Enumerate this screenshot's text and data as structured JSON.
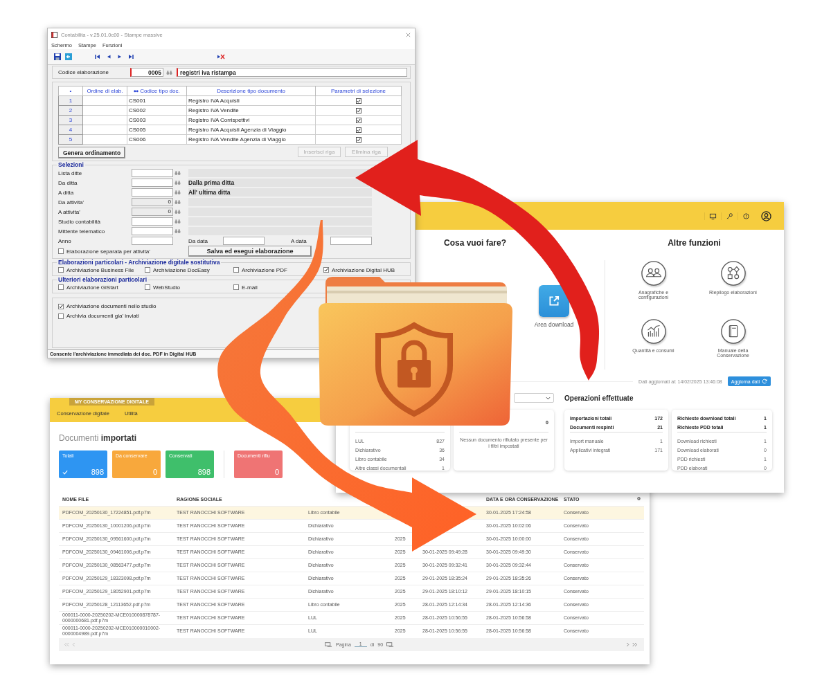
{
  "accounting_window": {
    "title": "Contabilita - v.25.01.0c00 - Stampe massive",
    "menu": [
      "Schermo",
      "Stampe",
      "Funzioni"
    ],
    "code_row": {
      "label": "Codice elaborazione",
      "code": "0005",
      "description": "registri iva ristampa"
    },
    "table": {
      "columns": [
        "•",
        "Ordine di elab.",
        "Codice tipo doc.",
        "Descrizione tipo documento",
        "Parametri di selezione"
      ],
      "rows": [
        {
          "index": "1",
          "code": "CS001",
          "description": "Registro IVA Acquisti",
          "checked": true
        },
        {
          "index": "2",
          "code": "CS002",
          "description": "Registro IVA Vendite",
          "checked": true
        },
        {
          "index": "3",
          "code": "CS003",
          "description": "Registro IVA Corrispettivi",
          "checked": true
        },
        {
          "index": "4",
          "code": "CS005",
          "description": "Registro IVA Acquisti Agenzia di Viaggio",
          "checked": true
        },
        {
          "index": "5",
          "code": "CS006",
          "description": "Registro IVA Vendite Agenzia di Viaggio",
          "checked": true
        }
      ]
    },
    "table_buttons": [
      {
        "label": "Genera ordinamento",
        "disabled": false
      },
      {
        "label": "Inserisci riga",
        "disabled": true
      },
      {
        "label": "Elimina riga",
        "disabled": true
      }
    ],
    "selezioni": {
      "title": "Selezioni",
      "fields": [
        {
          "label": "Lista ditte",
          "disabled": false
        },
        {
          "label": "Da ditta",
          "disabled": false,
          "info": "Dalla prima ditta"
        },
        {
          "label": "A ditta",
          "disabled": false,
          "info": "All' ultima ditta"
        },
        {
          "label": "Da attivita'",
          "disabled": true,
          "value": "0"
        },
        {
          "label": "A attivita'",
          "disabled": true,
          "value": "0"
        },
        {
          "label": "Studio contabilità",
          "disabled": false
        },
        {
          "label": "Mittente telematico",
          "disabled": false
        }
      ],
      "anno": {
        "label": "Anno",
        "from_label": "Da data",
        "to_label": "A data"
      },
      "separate": {
        "label": "Elaborazione separata per attivita'",
        "checked": false
      },
      "run_button": "Salva ed esegui elaborazione"
    },
    "elaborazioni": {
      "title": "Elaborazioni particolari - Archiviazione digitale sostitutiva",
      "options": [
        {
          "label": "Archiviazione Business File",
          "checked": false
        },
        {
          "label": "Archiviazione DocEasy",
          "checked": false
        },
        {
          "label": "Archiviazione PDF",
          "checked": false
        },
        {
          "label": "Archiviazione Digital HUB",
          "checked": true
        }
      ]
    },
    "ulteriori": {
      "title": "Ulteriori elaborazioni particolari",
      "options": [
        {
          "label": "Archiviazione GiStart",
          "checked": false
        },
        {
          "label": "WebStudio",
          "checked": false
        },
        {
          "label": "E-mail",
          "checked": false
        }
      ]
    },
    "archive_options": [
      {
        "label": "Archiviazione documenti nello studio",
        "checked": true
      },
      {
        "label": "Archivia documenti gia' inviati",
        "checked": false
      }
    ],
    "status_bar": "Consente l'archiviazione immediata dei doc. PDF in Digital HUB"
  },
  "dashboard_window": {
    "left_title": "Cosa vuoi fare?",
    "tile": "Area download",
    "right_title": "Altre funzioni",
    "functions": [
      {
        "label": "Anagrafiche e configurazioni",
        "kind": "people"
      },
      {
        "label": "Riepilogo elaborazioni",
        "kind": "shapes"
      },
      {
        "label": "Quantità e consumi",
        "kind": "chart"
      },
      {
        "label": "Manuale della Conservazione",
        "kind": "book"
      }
    ],
    "updated": "Dati aggiornati al: 14/02/2025 13:46:08",
    "refresh_button": "Aggiorna dati",
    "operations_title": "Operazioni effettuate",
    "cards": [
      {
        "rows": [
          {
            "label": "LUL",
            "value": "827"
          },
          {
            "label": "Dichiarativo",
            "value": "36"
          },
          {
            "label": "Libro contabile",
            "value": "34"
          },
          {
            "label": "Altre classi documentali",
            "value": "1"
          }
        ]
      },
      {
        "header": [
          {
            "value": "0"
          }
        ],
        "message": "Nessun documento rifiutato presente per i filtri impostati"
      },
      {
        "header": [
          {
            "label": "Importazioni totali",
            "value": "172"
          },
          {
            "label": "Documenti respinti",
            "value": "21"
          }
        ],
        "rows": [
          {
            "label": "Import manuale",
            "value": "1"
          },
          {
            "label": "Applicativi integrati",
            "value": "171"
          }
        ]
      },
      {
        "header": [
          {
            "label": "Richieste download totali",
            "value": "1"
          },
          {
            "label": "Richieste PDD totali",
            "value": "1"
          }
        ],
        "rows": [
          {
            "label": "Download richiesti",
            "value": "1"
          },
          {
            "label": "Download elaborati",
            "value": "0"
          },
          {
            "label": "PDD richiesti",
            "value": "1"
          },
          {
            "label": "PDD elaborati",
            "value": "0"
          }
        ]
      }
    ]
  },
  "archive_window": {
    "app_tab": "MY CONSERVAZIONE DIGITALE",
    "nav": [
      "Conservazione digitale",
      "Utilità"
    ],
    "page_title": "Documenti **importati**",
    "counters": [
      {
        "label": "Totali",
        "value": "898",
        "color": "#2e95f2",
        "selected": true
      },
      {
        "label": "Da conservare",
        "value": "0",
        "color": "#f8a83c",
        "selected": false
      },
      {
        "label": "Conservati",
        "value": "898",
        "color": "#3fbf6b",
        "selected": false
      }
    ],
    "rejected_counter": {
      "label": "Documenti rifiu",
      "value": "0",
      "color": "#ef7474"
    },
    "table": {
      "columns": [
        "NOME FILE",
        "RAGIONE SOCIALE",
        null,
        null,
        null,
        "DATA E ORA CONSERVAZIONE",
        "STATO"
      ],
      "rows": [
        {
          "selected": true,
          "cells": [
            "PDFCOM_20250130_17224851.pdf.p7m",
            "TEST RANOCCHI SOFTWARE",
            "Libro contabile",
            null,
            null,
            "30-01-2025 17:24:58",
            "Conservato"
          ]
        },
        {
          "selected": false,
          "cells": [
            "PDFCOM_20250130_10001206.pdf.p7m",
            "TEST RANOCCHI SOFTWARE",
            "Dichiarativo",
            null,
            null,
            "30-01-2025 10:02:06",
            "Conservato"
          ]
        },
        {
          "selected": false,
          "cells": [
            "PDFCOM_20250130_09561600.pdf.p7m",
            "TEST RANOCCHI SOFTWARE",
            "Dichiarativo",
            "2025",
            null,
            "30-01-2025 10:00:00",
            "Conservato"
          ]
        },
        {
          "selected": false,
          "cells": [
            "PDFCOM_20250130_09461006.pdf.p7m",
            "TEST RANOCCHI SOFTWARE",
            "Dichiarativo",
            "2025",
            "30-01-2025 09:49:28",
            "30-01-2025 09:49:30",
            "Conservato"
          ]
        },
        {
          "selected": false,
          "cells": [
            "PDFCOM_20250130_08563477.pdf.p7m",
            "TEST RANOCCHI SOFTWARE",
            "Dichiarativo",
            "2025",
            "30-01-2025 09:32:41",
            "30-01-2025 09:32:44",
            "Conservato"
          ]
        },
        {
          "selected": false,
          "cells": [
            "PDFCOM_20250129_18323098.pdf.p7m",
            "TEST RANOCCHI SOFTWARE",
            "Dichiarativo",
            "2025",
            "29-01-2025 18:35:24",
            "29-01-2025 18:35:26",
            "Conservato"
          ]
        },
        {
          "selected": false,
          "cells": [
            "PDFCOM_20250129_18052901.pdf.p7m",
            "TEST RANOCCHI SOFTWARE",
            "Dichiarativo",
            "2025",
            "29-01-2025 18:10:12",
            "29-01-2025 18:10:15",
            "Conservato"
          ]
        },
        {
          "selected": false,
          "cells": [
            "PDFCOM_20250128_12113652.pdf.p7m",
            "TEST RANOCCHI SOFTWARE",
            "Libro contabile",
            "2025",
            "28-01-2025 12:14:34",
            "28-01-2025 12:14:36",
            "Conservato"
          ]
        },
        {
          "selected": false,
          "cells": [
            "000011-0000-20250202-MCE010000878787-0000000681.pdf.p7m",
            "TEST RANOCCHI SOFTWARE",
            "LUL",
            "2025",
            "28-01-2025 10:56:55",
            "28-01-2025 10:56:58",
            "Conservato"
          ]
        },
        {
          "selected": false,
          "cells": [
            "000011-0000-20250202-MCE010000010002-0000004989.pdf.p7m",
            "TEST RANOCCHI SOFTWARE",
            "LUL",
            "2025",
            "28-01-2025 10:56:55",
            "28-01-2025 10:56:58",
            "Conservato"
          ]
        }
      ]
    },
    "pagination": {
      "page_label": "Pagina",
      "page": "1",
      "of_label": "di",
      "total": "90"
    }
  }
}
